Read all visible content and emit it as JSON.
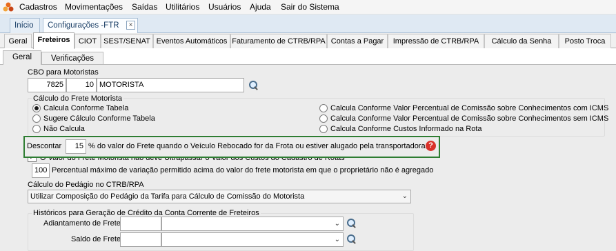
{
  "menu": {
    "items": [
      "Cadastros",
      "Movimentações",
      "Saídas",
      "Utilitários",
      "Usuários",
      "Ajuda",
      "Sair do Sistema"
    ]
  },
  "doc_tabs": {
    "home": "Início",
    "active": "Configurações -FTR"
  },
  "module_tabs": [
    "Geral",
    "Freteiros",
    "CIOT",
    "SEST/SENAT",
    "Eventos Automáticos",
    "Faturamento de CTRB/RPA",
    "Contas a Pagar",
    "Impressão de CTRB/RPA",
    "Cálculo da Senha",
    "Posto Troca"
  ],
  "sub_tabs": [
    "Geral",
    "Verificações"
  ],
  "cbo": {
    "label": "CBO para Motoristas",
    "code": "7825",
    "sub": "10",
    "description": "MOTORISTA"
  },
  "calculo_frete": {
    "label": "Cálculo do Frete Motorista",
    "options_left": [
      "Calcula Conforme Tabela",
      "Sugere Cálculo Conforme Tabela",
      "Não Calcula"
    ],
    "options_right": [
      "Calcula Conforme Valor Percentual de Comissão sobre Conhecimentos com ICMS",
      "Calcula Conforme Valor Percentual de Comissão sobre Conhecimentos sem ICMS",
      "Calcula Conforme Custos Informado na Rota"
    ],
    "selected": "Calcula Conforme Tabela"
  },
  "descontar": {
    "prefix": "Descontar",
    "value": "15",
    "suffix": "% do valor do Frete quando o Veículo Rebocado for da Frota ou estiver alugado pela transportadora."
  },
  "checkbox_partial": "O Valor do Frete Motorista não deve Ultrapassar o Valor dos Custos do Cadastro de Rotas",
  "percentual": {
    "value": "100",
    "label": "Percentual máximo de variação permitido acima do valor do frete motorista em que o proprietário não é agregado"
  },
  "pedagio": {
    "label": "Cálculo do Pedágio no CTRB/RPA",
    "selected": "Utilizar Composição do Pedágio da Tarifa para Cálculo de Comissão do Motorista"
  },
  "historicos": {
    "label": "Históricos para Geração de Crédito da Conta Corrente de Freteiros",
    "adiantamento_label": "Adiantamento de Frete",
    "saldo_label": "Saldo de Frete"
  },
  "icons": {
    "search": "search-icon",
    "help": "help-icon",
    "close": "close-icon",
    "dropdown": "chevron-down-icon"
  },
  "colors": {
    "highlight": "#2e7d32",
    "help": "#d9312a"
  }
}
